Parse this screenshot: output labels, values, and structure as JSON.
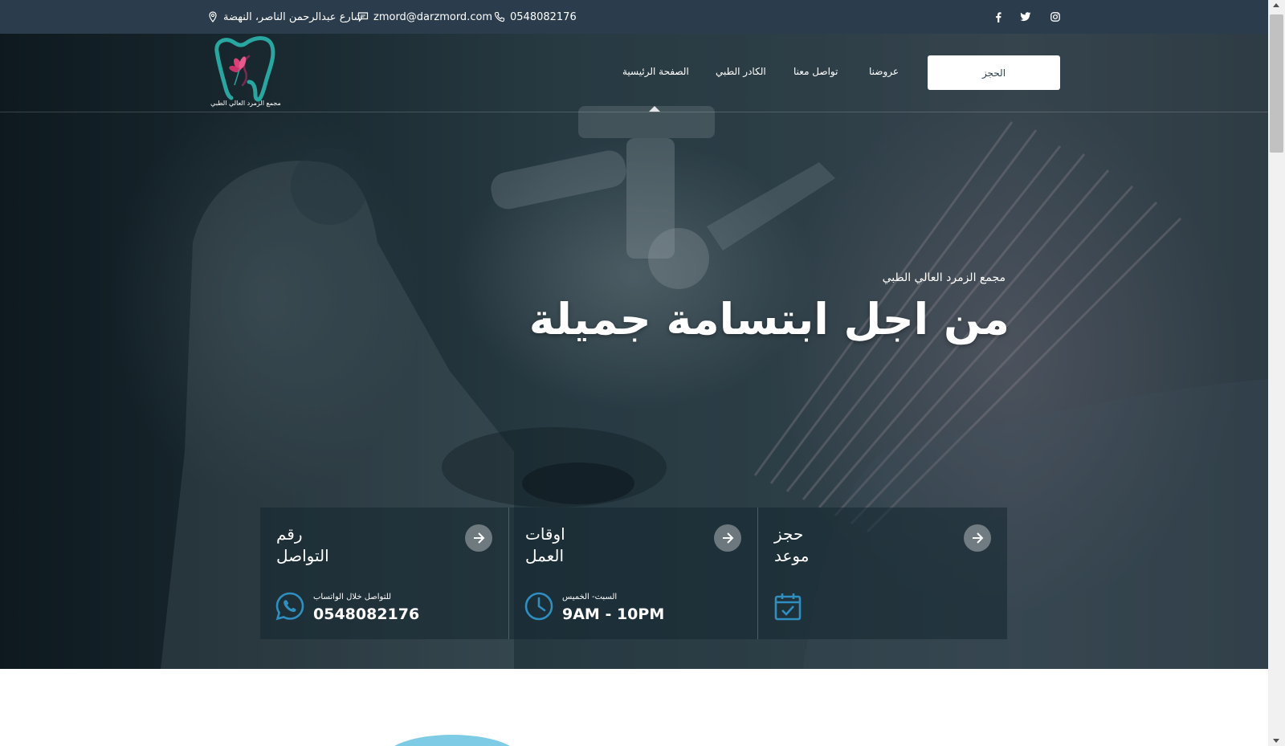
{
  "topbar": {
    "address": "شارع عبدالرحمن الناصر، النهضة",
    "email": "zmord@darzmord.com",
    "phone": "0548082176",
    "social_icons": [
      "facebook-icon",
      "twitter-icon",
      "instagram-icon"
    ]
  },
  "brand": {
    "logo_text": "مجمع الزمرد العالي الطبي",
    "logo_colors": {
      "tooth": "#2aa6a0",
      "flower": "#e0407a",
      "face": "#7a2a52"
    }
  },
  "nav": {
    "items": [
      {
        "label": "الصفحة الرئيسية"
      },
      {
        "label": "الكادر الطبي"
      },
      {
        "label": "تواصل معنا"
      },
      {
        "label": "عروضنا"
      }
    ],
    "book_button": "الحجز"
  },
  "hero": {
    "subtitle": "مجمع الزمرد العالي الطبي",
    "title": "من اجل ابتسامة جميلة"
  },
  "cards": [
    {
      "title": "رقم\nالتواصل",
      "small": "للتواصل خلال الواتساب",
      "big": "0548082176",
      "icon": "whatsapp-icon"
    },
    {
      "title": "اوقات\nالعمل",
      "small": "السبت- الخميس",
      "big": "9AM - 10PM",
      "icon": "clock-icon"
    },
    {
      "title": "حجز\nموعد",
      "small": "",
      "big": "",
      "icon": "calendar-check-icon"
    }
  ],
  "colors": {
    "topbar": "#2b3c4c",
    "accent": "#2f8fc0",
    "white": "#ffffff"
  }
}
